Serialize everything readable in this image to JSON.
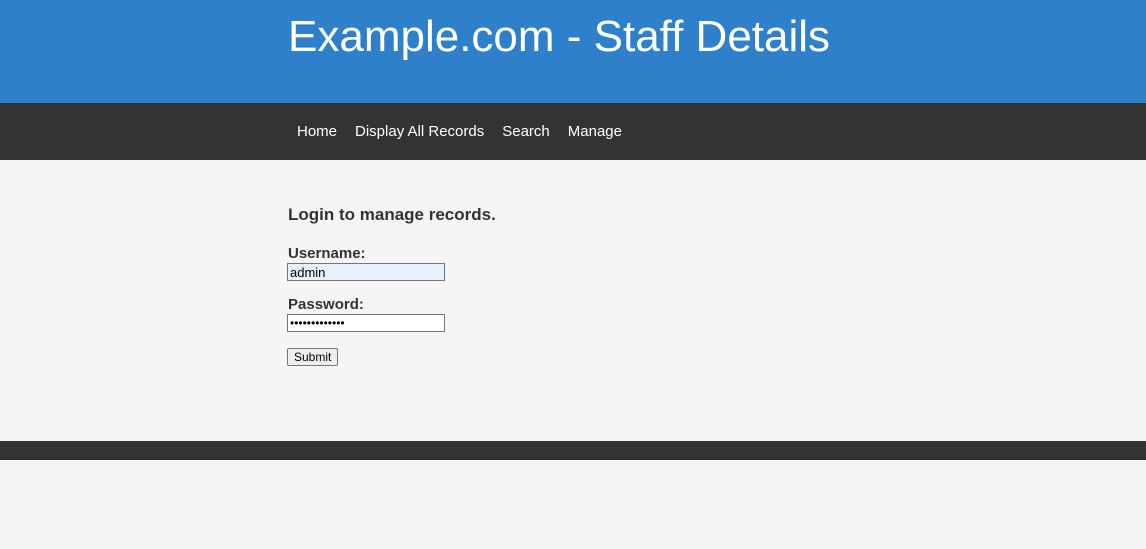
{
  "header": {
    "title": "Example.com - Staff Details"
  },
  "nav": {
    "items": [
      {
        "label": "Home"
      },
      {
        "label": "Display All Records"
      },
      {
        "label": "Search"
      },
      {
        "label": "Manage"
      }
    ]
  },
  "login": {
    "heading": "Login to manage records.",
    "username_label": "Username:",
    "username_value": "admin",
    "password_label": "Password:",
    "password_masked": "•••••••••••••",
    "submit_label": "Submit"
  },
  "colors": {
    "header_bg": "#2e80ca",
    "nav_bg": "#333333",
    "page_bg": "#f5f5f5",
    "autofill_bg": "#e8f0fe"
  }
}
